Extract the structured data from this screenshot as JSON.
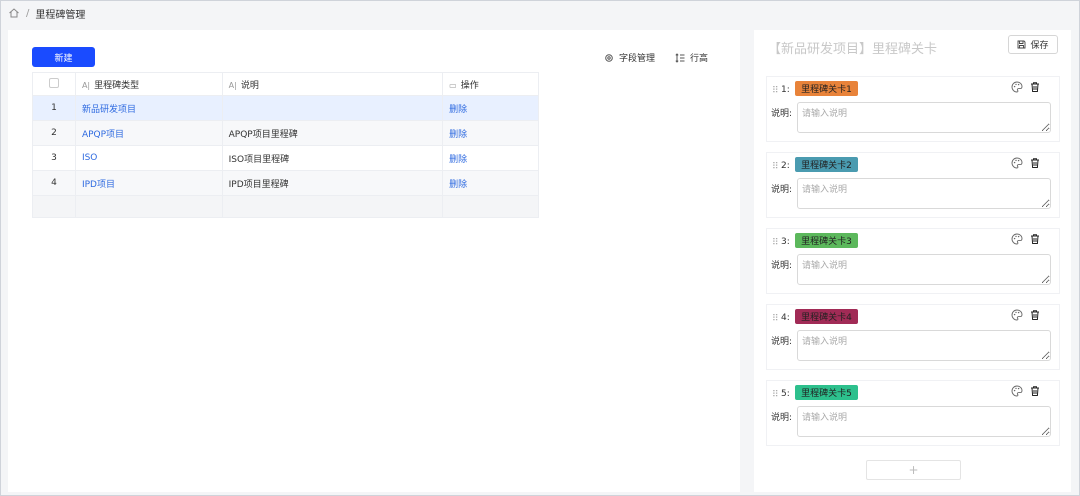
{
  "breadcrumb": {
    "current": "里程碑管理"
  },
  "toolbar": {
    "new_label": "新建",
    "field_manage_label": "字段管理",
    "row_height_label": "行高"
  },
  "table": {
    "headers": {
      "type": "里程碑类型",
      "desc": "说明",
      "ops": "操作"
    },
    "rows": [
      {
        "index": "1",
        "type": "新品研发项目",
        "desc": "",
        "op": "删除"
      },
      {
        "index": "2",
        "type": "APQP项目",
        "desc": "APQP项目里程碑",
        "op": "删除"
      },
      {
        "index": "3",
        "type": "ISO",
        "desc": "ISO项目里程碑",
        "op": "删除"
      },
      {
        "index": "4",
        "type": "IPD项目",
        "desc": "IPD项目里程碑",
        "op": "删除"
      }
    ]
  },
  "panel": {
    "title": "【新品研发项目】里程碑关卡",
    "save_label": "保存",
    "desc_label": "说明:",
    "desc_placeholder": "请输入说明",
    "add_label": "+",
    "stages": [
      {
        "num": "1:",
        "name": "里程碑关卡1",
        "color": "#e8833a"
      },
      {
        "num": "2:",
        "name": "里程碑关卡2",
        "color": "#4a9bb0"
      },
      {
        "num": "3:",
        "name": "里程碑关卡3",
        "color": "#5cb85c"
      },
      {
        "num": "4:",
        "name": "里程碑关卡4",
        "color": "#a12b56"
      },
      {
        "num": "5:",
        "name": "里程碑关卡5",
        "color": "#2dc08d"
      }
    ]
  }
}
